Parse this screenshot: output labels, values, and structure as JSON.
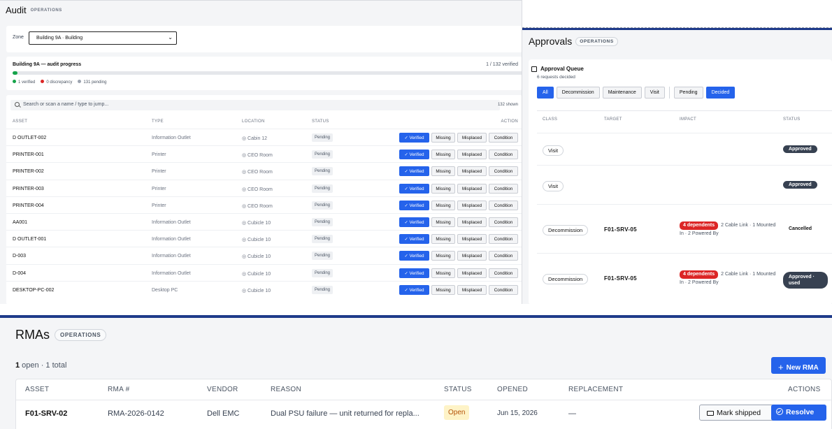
{
  "audit": {
    "title": "Audit",
    "pill": "OPERATIONS",
    "zone_label": "Zone",
    "zone_value": "Building 9A · Building",
    "progress_title": "Building 9A — audit progress",
    "progress_count": "1 / 132 verified",
    "progress_fraction": 0.0076,
    "legend": {
      "verified": "1 verified",
      "discrepancy": "0 discrepancy",
      "pending": "131 pending"
    },
    "colors": {
      "verified": "#16a34a",
      "discrepancy": "#dc2626",
      "pending": "#9ca3af",
      "accent": "#2563eb"
    },
    "search_placeholder": "Search or scan a name / type to jump...",
    "shown": "132 shown",
    "columns": {
      "asset": "ASSET",
      "type": "TYPE",
      "location": "LOCATION",
      "status": "STATUS",
      "action": "ACTION"
    },
    "actions": {
      "verified": "✓ Verified",
      "missing": "Missing",
      "misplaced": "Misplaced",
      "condition": "Condition"
    },
    "rows": [
      {
        "asset": "D OUTLET-002",
        "type": "Information Outlet",
        "location": "◎ Cabin 12",
        "status": "Pending"
      },
      {
        "asset": "PRINTER-001",
        "type": "Printer",
        "location": "◎ CEO Room",
        "status": "Pending"
      },
      {
        "asset": "PRINTER-002",
        "type": "Printer",
        "location": "◎ CEO Room",
        "status": "Pending"
      },
      {
        "asset": "PRINTER-003",
        "type": "Printer",
        "location": "◎ CEO Room",
        "status": "Pending"
      },
      {
        "asset": "PRINTER-004",
        "type": "Printer",
        "location": "◎ CEO Room",
        "status": "Pending"
      },
      {
        "asset": "AA001",
        "type": "Information Outlet",
        "location": "◎ Cubicle 10",
        "status": "Pending"
      },
      {
        "asset": "D OUTLET-001",
        "type": "Information Outlet",
        "location": "◎ Cubicle 10",
        "status": "Pending"
      },
      {
        "asset": "D-003",
        "type": "Information Outlet",
        "location": "◎ Cubicle 10",
        "status": "Pending"
      },
      {
        "asset": "D-004",
        "type": "Information Outlet",
        "location": "◎ Cubicle 10",
        "status": "Pending"
      },
      {
        "asset": "DESKTOP-PC-002",
        "type": "Desktop PC",
        "location": "◎ Cubicle 10",
        "status": "Pending"
      }
    ]
  },
  "approvals": {
    "title": "Approvals",
    "pill": "OPERATIONS",
    "queue_title": "Approval Queue",
    "queue_subtitle": "6 requests decided",
    "filters": [
      "All",
      "Decommission",
      "Maintenance",
      "Visit"
    ],
    "status_filters": [
      "Pending",
      "Decided"
    ],
    "columns": {
      "class": "CLASS",
      "target": "TARGET",
      "impact": "IMPACT",
      "status": "STATUS"
    },
    "rows": [
      {
        "class": "Visit",
        "target": "",
        "dependents": "",
        "impact": "",
        "status": "Approved",
        "dark": true
      },
      {
        "class": "Visit",
        "target": "",
        "dependents": "",
        "impact": "",
        "status": "Approved",
        "dark": true
      },
      {
        "class": "Decommission",
        "target": "F01-SRV-05",
        "dependents": "4 dependents",
        "impact": "2 Cable Link · 1 Mounted In · 2 Powered By",
        "status": "Cancelled",
        "dark": false
      },
      {
        "class": "Decommission",
        "target": "F01-SRV-05",
        "dependents": "4 dependents",
        "impact": "2 Cable Link · 1 Mounted In · 2 Powered By",
        "status": "Approved · used",
        "dark": true
      }
    ]
  },
  "rmas": {
    "title": "RMAs",
    "pill": "OPERATIONS",
    "count_open": "1",
    "count_rest": " open · 1 total",
    "new_button": "New RMA",
    "columns": {
      "asset": "ASSET",
      "rma": "RMA #",
      "vendor": "VENDOR",
      "reason": "REASON",
      "status": "STATUS",
      "opened": "OPENED",
      "replacement": "REPLACEMENT",
      "actions": "ACTIONS"
    },
    "row": {
      "asset": "F01-SRV-02",
      "rma": "RMA-2026-0142",
      "vendor": "Dell EMC",
      "reason": "Dual PSU failure — unit returned for repla...",
      "status": "Open",
      "opened": "Jun 15, 2026",
      "replacement": "—"
    },
    "mark_shipped": "Mark shipped",
    "resolve": "Resolve"
  }
}
